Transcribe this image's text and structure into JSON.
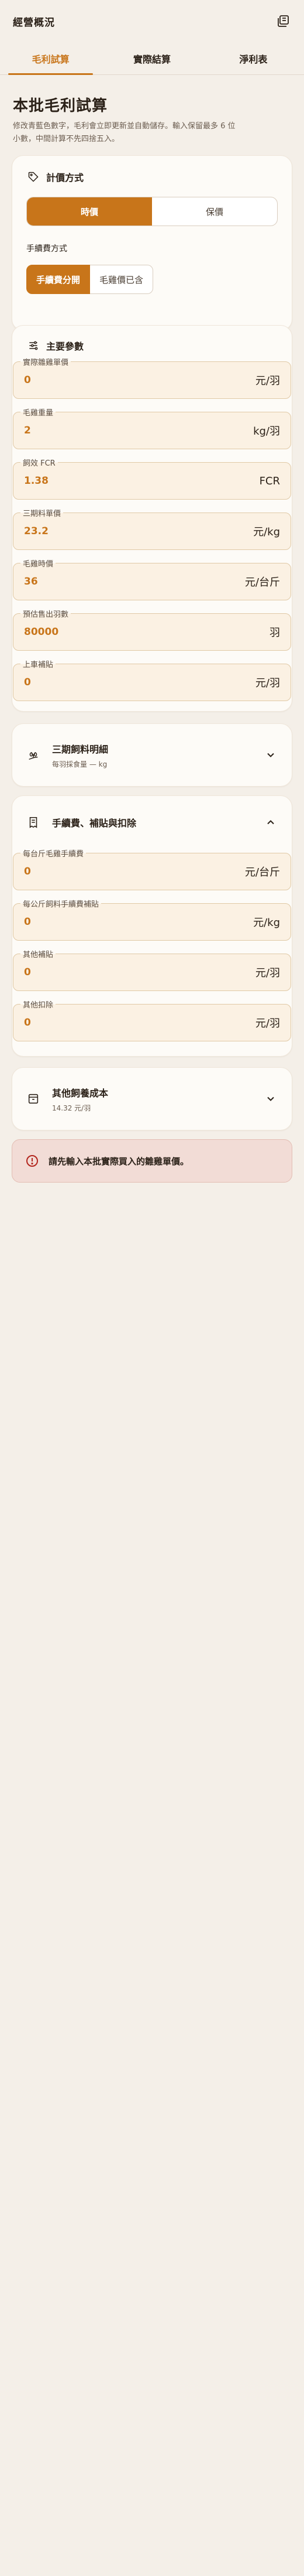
{
  "header": {
    "title": "經營概況",
    "layers_icon": "layers-icon"
  },
  "tabs": [
    {
      "label": "毛利試算",
      "active": true
    },
    {
      "label": "實際結算",
      "active": false
    },
    {
      "label": "淨利表",
      "active": false
    }
  ],
  "page": {
    "title": "本批毛利試算",
    "desc_line1": "修改青藍色數字，毛利會立即更新並自動儲存。輸入保留最多 6 位",
    "desc_line2": "小數，中間計算不先四捨五入。"
  },
  "pricing": {
    "title": "計價方式",
    "options": [
      "時價",
      "保價"
    ],
    "selected": "時價",
    "fee_label": "手續費方式",
    "fee_options": [
      "手續費分開",
      "毛雞價已含"
    ],
    "fee_selected": "手續費分開"
  },
  "params": {
    "title": "主要參數",
    "fields": [
      {
        "label": "實際雛雞單價",
        "value": "0",
        "unit": "元/羽"
      },
      {
        "label": "毛雞重量",
        "value": "2",
        "unit": "kg/羽"
      },
      {
        "label": "飼效 FCR",
        "value": "1.38",
        "unit": "FCR"
      },
      {
        "label": "三期料單價",
        "value": "23.2",
        "unit": "元/kg"
      },
      {
        "label": "毛雞時價",
        "value": "36",
        "unit": "元/台斤"
      },
      {
        "label": "預估售出羽數",
        "value": "80000",
        "unit": "羽"
      },
      {
        "label": "上車補貼",
        "value": "0",
        "unit": "元/羽"
      }
    ]
  },
  "feed_detail": {
    "title": "三期飼料明細",
    "sub": "每羽採食量 — kg"
  },
  "fees": {
    "title": "手續費、補貼與扣除",
    "fields": [
      {
        "label": "每台斤毛雞手續費",
        "value": "0",
        "unit": "元/台斤"
      },
      {
        "label": "每公斤飼料手續費補貼",
        "value": "0",
        "unit": "元/kg"
      },
      {
        "label": "其他補貼",
        "value": "0",
        "unit": "元/羽"
      },
      {
        "label": "其他扣除",
        "value": "0",
        "unit": "元/羽"
      }
    ]
  },
  "other_cost": {
    "title": "其他飼養成本",
    "sub": "14.32 元/羽"
  },
  "alert": {
    "text": "請先輸入本批實際買入的雛雞單價。"
  },
  "colors": {
    "accent": "#c8751a",
    "background": "#f4efe8",
    "card": "#fdfbf7",
    "alert_bg": "#f2dcd6"
  }
}
